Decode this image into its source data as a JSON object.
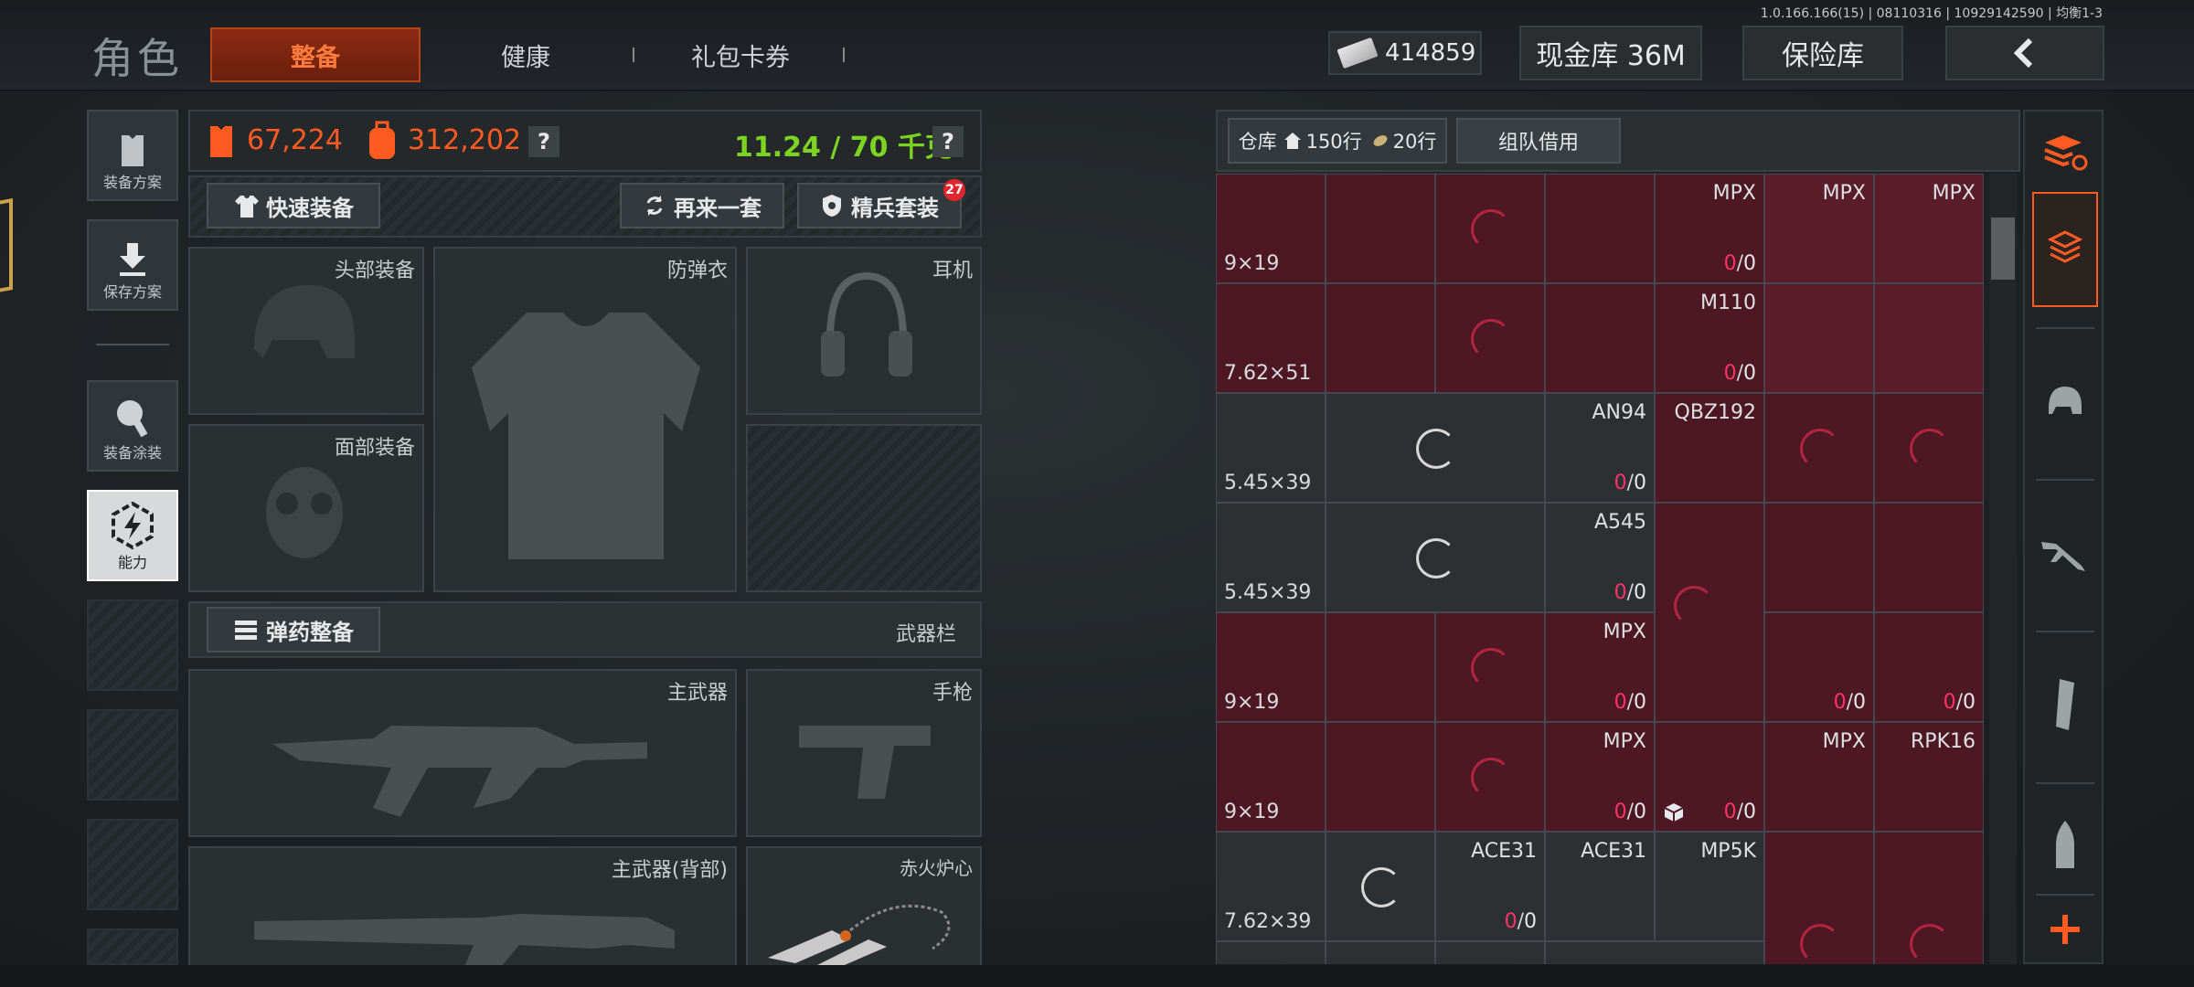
{
  "version": "1.0.166.166(15) | 08110316 | 10929142590 | 均衡1-3",
  "header": {
    "title": "角色",
    "tabs": [
      {
        "label": "整备"
      },
      {
        "label": "健康"
      },
      {
        "label": "礼包卡券"
      }
    ],
    "money": "414859",
    "cash_vault": "现金库 36M",
    "insurance": "保险库",
    "back_icon": "chevron-left-icon"
  },
  "left_sidebar": {
    "items": [
      {
        "label": "装备方案",
        "icon": "vest-icon"
      },
      {
        "label": "保存方案",
        "icon": "download-icon"
      },
      {
        "label": "装备涂装",
        "icon": "paint-icon"
      },
      {
        "label": "能力",
        "icon": "lightning-icon"
      }
    ]
  },
  "stats": {
    "armor_value": "67,224",
    "bag_value": "312,202",
    "weight": "11.24 / 70 千克",
    "help": "?"
  },
  "actions": {
    "quick_equip": "快速装备",
    "again": "再来一套",
    "elite": "精兵套装",
    "elite_badge": "27"
  },
  "slots": {
    "head": "头部装备",
    "vest": "防弹衣",
    "headset": "耳机",
    "face": "面部装备",
    "ammo_btn": "弹药整备",
    "weapon_bar": "武器栏",
    "main_weapon": "主武器",
    "pistol": "手枪",
    "main_weapon_back": "主武器(背部)",
    "melee": "赤火炉心"
  },
  "warehouse": {
    "label": "仓库",
    "rows1": "150行",
    "rows2": "20行",
    "team_borrow": "组队借用"
  },
  "grid_rows": [
    {
      "caliber": "9×19",
      "cells": [
        {
          "name": "MPX",
          "cnt": [
            "0",
            "0"
          ]
        },
        {
          "name": "MPX"
        },
        {
          "name": "MPX"
        }
      ]
    },
    {
      "caliber": "7.62×51",
      "cells": [
        {
          "name": "M110",
          "cnt": [
            "0",
            "0"
          ]
        }
      ]
    },
    {
      "caliber": "5.45×39",
      "cells": [
        {
          "name": "AN94",
          "cnt": [
            "0",
            "0"
          ]
        },
        {
          "name": "QBZ192"
        }
      ]
    },
    {
      "caliber": "5.45×39",
      "cells": [
        {
          "name": "A545",
          "cnt": [
            "0",
            "0"
          ]
        }
      ]
    },
    {
      "caliber": "9×19",
      "cells": [
        {
          "name": "MPX",
          "cnt": [
            "0",
            "0"
          ]
        },
        {
          "cnt": [
            "0",
            "0"
          ]
        },
        {
          "cnt": [
            "0",
            "0"
          ]
        }
      ]
    },
    {
      "caliber": "9×19",
      "cells": [
        {
          "name": "MPX",
          "cnt": [
            "0",
            "0"
          ]
        },
        {
          "cnt": [
            "0",
            "0"
          ]
        },
        {
          "name": "MPX"
        },
        {
          "name": "RPK16"
        }
      ]
    },
    {
      "caliber": "7.62×39",
      "cells": [
        {
          "name": "ACE31",
          "cnt": [
            "0",
            "0"
          ]
        },
        {
          "name": "ACE31"
        },
        {
          "name": "MP5K"
        }
      ]
    }
  ],
  "colors": {
    "accent": "#ff5a1f",
    "red_cell": "#4d1824",
    "green": "#7dd321",
    "count_red": "#ff3366"
  }
}
